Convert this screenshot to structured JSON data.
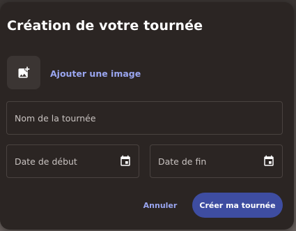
{
  "dialog": {
    "title": "Création de votre tournée",
    "add_image": {
      "icon": "add-photo-icon",
      "label": "Ajouter une image"
    },
    "name_field": {
      "value": "",
      "placeholder": "Nom de la tournée"
    },
    "start_date_field": {
      "value": "",
      "placeholder": "Date de début",
      "icon": "calendar-icon"
    },
    "end_date_field": {
      "value": "",
      "placeholder": "Date de fin",
      "icon": "calendar-icon"
    },
    "actions": {
      "cancel_label": "Annuler",
      "submit_label": "Créer ma tournée"
    }
  },
  "colors": {
    "dialog_background": "#2b2523",
    "accent_link": "#9aa6f0",
    "primary_button": "#3e4da1",
    "text_primary": "#ffffff"
  }
}
